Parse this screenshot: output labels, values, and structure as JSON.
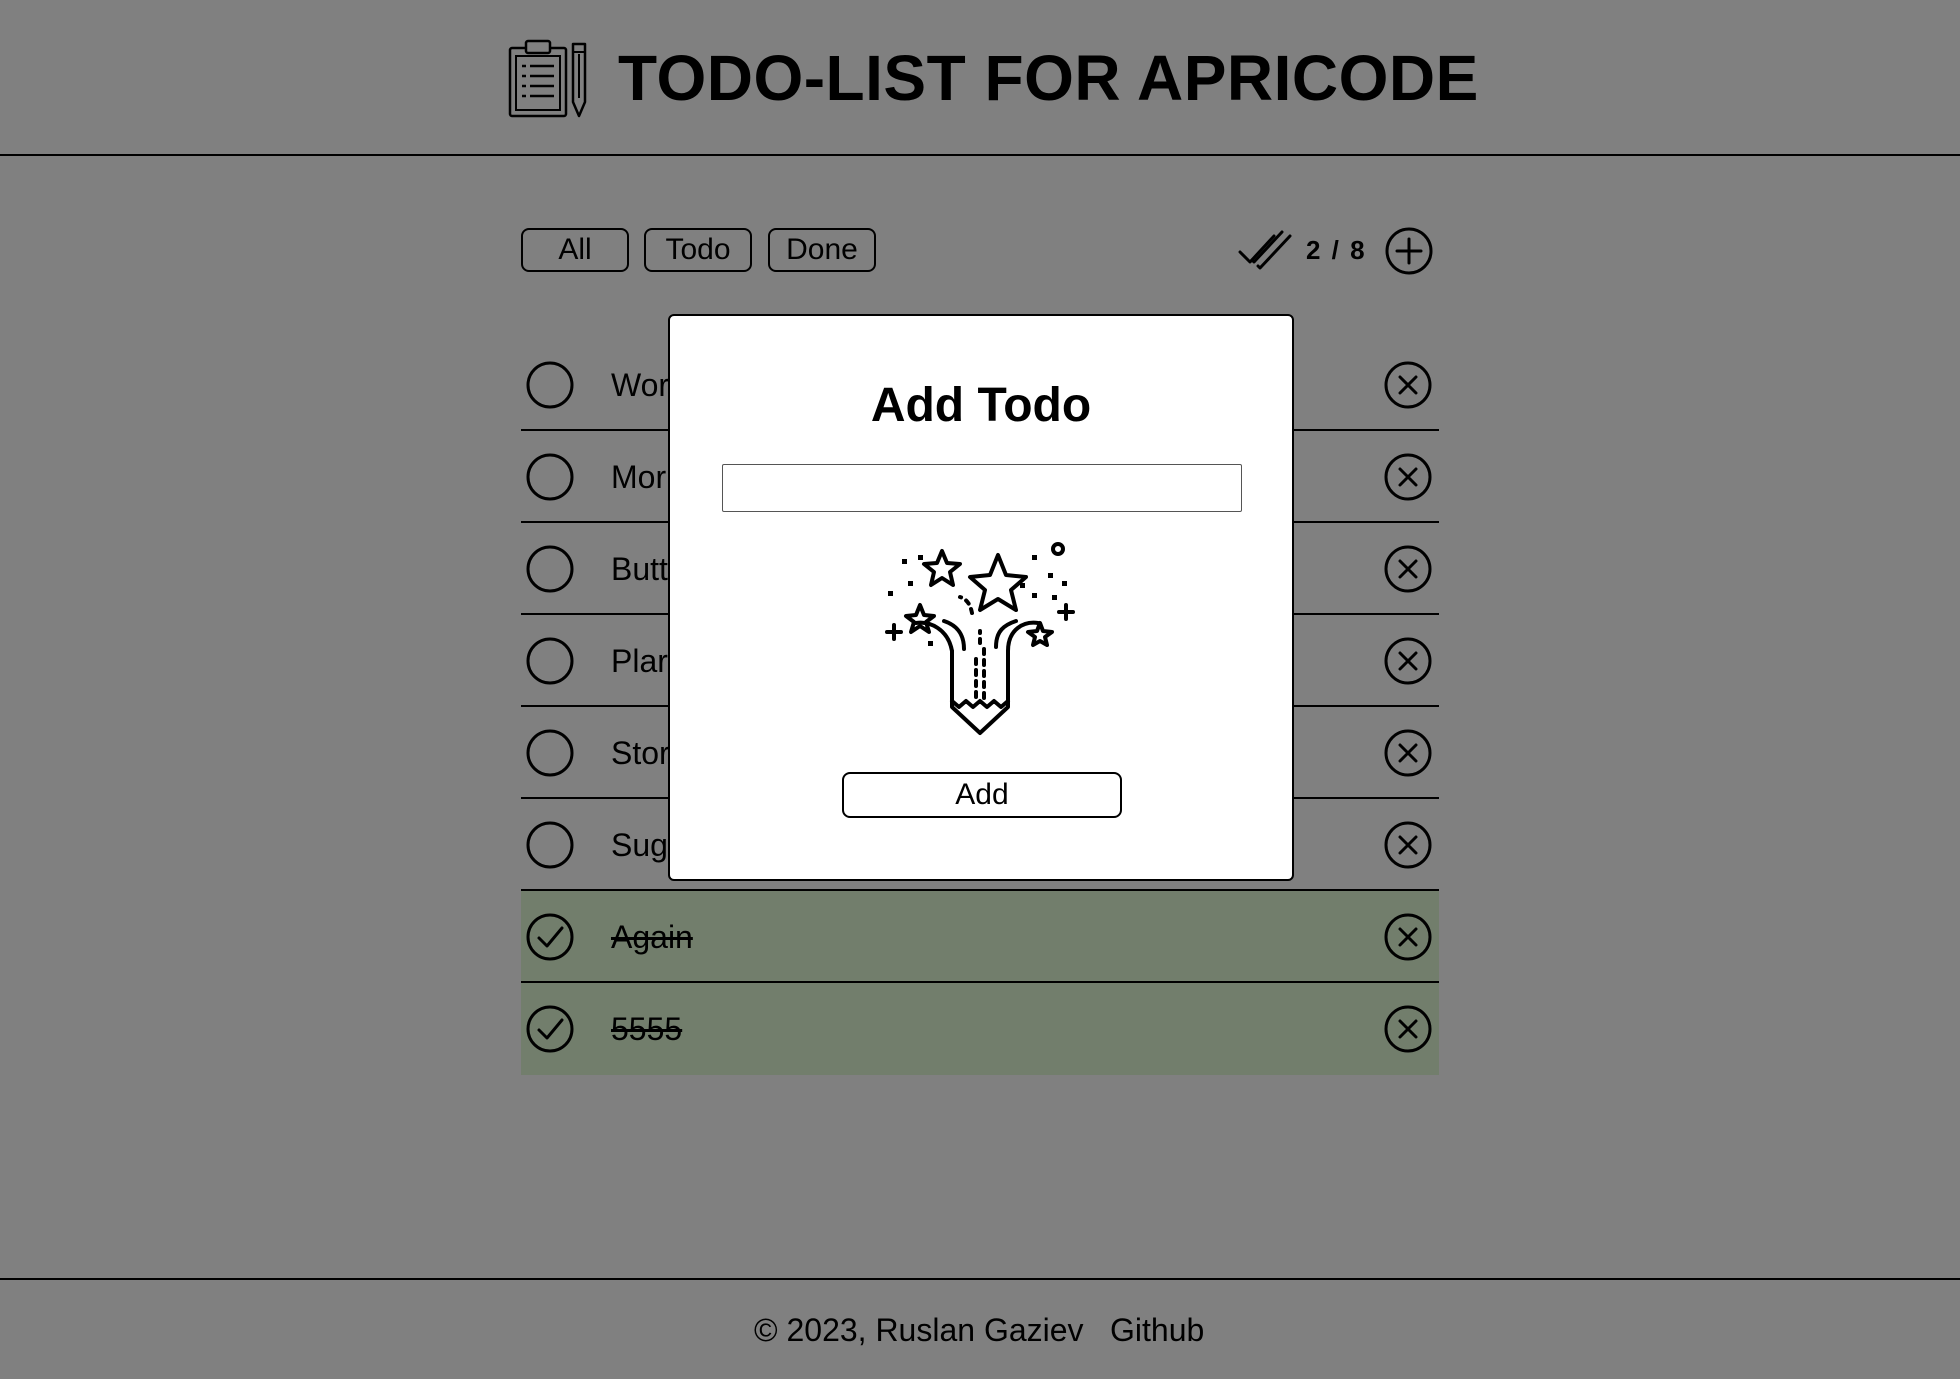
{
  "header": {
    "title": "TODO-LIST FOR APRICODE",
    "logo_icon": "clipboard-pencil-icon"
  },
  "filters": [
    {
      "label": "All"
    },
    {
      "label": "Todo"
    },
    {
      "label": "Done"
    }
  ],
  "counter": {
    "text": "2 / 8",
    "icon": "double-check-icon"
  },
  "add_icon": "plus-circle-icon",
  "todos": [
    {
      "text": "Wor",
      "done": false
    },
    {
      "text": "Mor",
      "done": false
    },
    {
      "text": "Butt",
      "done": false
    },
    {
      "text": "Plar",
      "done": false
    },
    {
      "text": "Stor",
      "done": false
    },
    {
      "text": "Sug",
      "done": false
    },
    {
      "text": "Again",
      "done": true
    },
    {
      "text": "5555",
      "done": true
    }
  ],
  "modal": {
    "title": "Add Todo",
    "input_value": "",
    "input_placeholder": "",
    "illustration": "pencil-fireworks-icon",
    "add_label": "Add"
  },
  "footer": {
    "copyright": "© 2023, Ruslan Gaziev",
    "link": "Github"
  },
  "colors": {
    "background": "#808080",
    "done_row": "#727e6c",
    "modal_bg": "#ffffff",
    "text": "#000000"
  }
}
